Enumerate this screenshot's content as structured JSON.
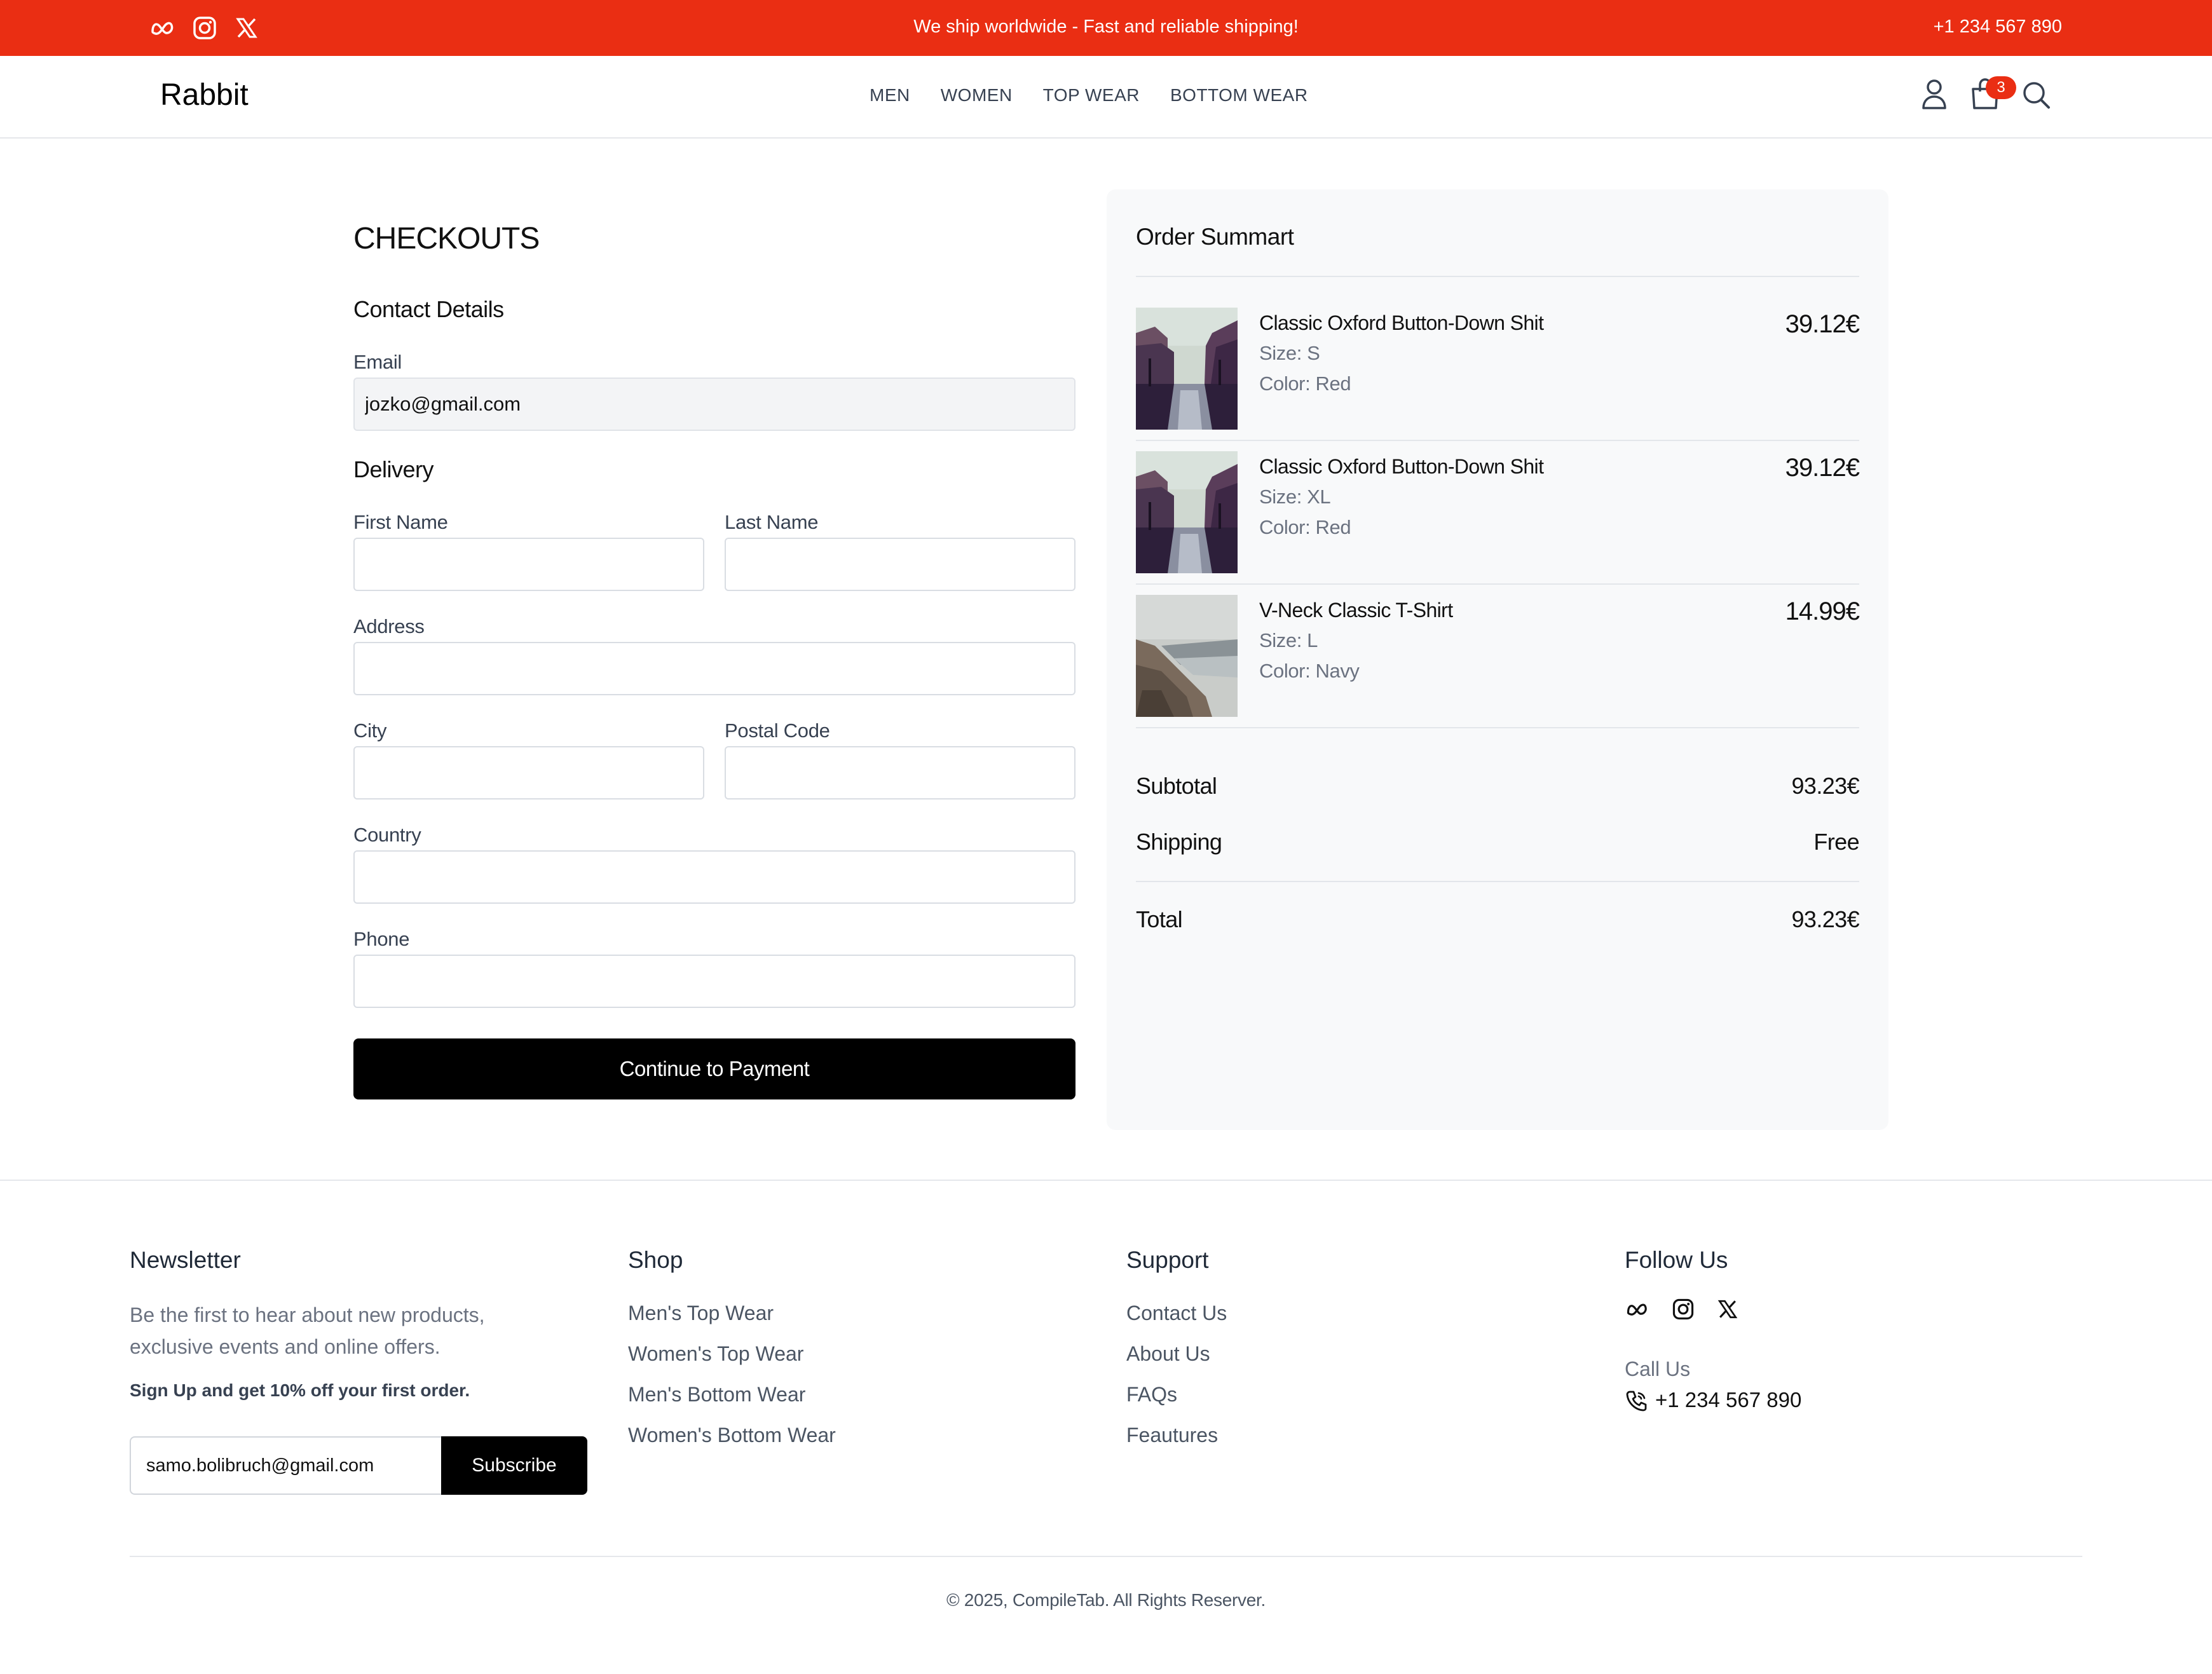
{
  "topbar": {
    "social_icons": [
      "meta-icon",
      "instagram-icon",
      "x-icon"
    ],
    "message": "We ship worldwide - Fast and reliable shipping!",
    "phone": "+1 234 567 890",
    "color": "#ea2e13"
  },
  "navbar": {
    "logo": "Rabbit",
    "links": [
      "MEN",
      "WOMEN",
      "TOP WEAR",
      "BOTTOM WEAR"
    ],
    "icons": [
      "user-icon",
      "shopping-bag-icon",
      "search-icon"
    ],
    "cart_count": "3"
  },
  "checkout": {
    "title": "CHECKOUTS",
    "contact_title": "Contact Details",
    "email_label": "Email",
    "email_value": "jozko@gmail.com",
    "delivery_title": "Delivery",
    "first_name_label": "First Name",
    "last_name_label": "Last Name",
    "address_label": "Address",
    "city_label": "City",
    "postal_label": "Postal Code",
    "country_label": "Country",
    "phone_label": "Phone",
    "submit_label": "Continue to Payment"
  },
  "summary": {
    "title": "Order Summart",
    "items": [
      {
        "name": "Classic Oxford Button-Down Shit",
        "size": "Size: S",
        "color": "Color: Red",
        "price": "39.12€"
      },
      {
        "name": "Classic Oxford Button-Down Shit",
        "size": "Size: XL",
        "color": "Color: Red",
        "price": "39.12€"
      },
      {
        "name": "V-Neck Classic T-Shirt",
        "size": "Size: L",
        "color": "Color: Navy",
        "price": "14.99€"
      }
    ],
    "subtotal_label": "Subtotal",
    "subtotal_value": "93.23€",
    "shipping_label": "Shipping",
    "shipping_value": "Free",
    "total_label": "Total",
    "total_value": "93.23€"
  },
  "footer": {
    "newsletter": {
      "title": "Newsletter",
      "text": "Be the first to hear about new products, exclusive events and online offers.",
      "bold": "Sign Up and get 10% off your first order.",
      "email_value": "samo.bolibruch@gmail.com",
      "button": "Subscribe"
    },
    "shop": {
      "title": "Shop",
      "links": [
        "Men's Top Wear",
        "Women's Top Wear",
        "Men's Bottom Wear",
        "Women's Bottom Wear"
      ]
    },
    "support": {
      "title": "Support",
      "links": [
        "Contact Us",
        "About Us",
        "FAQs",
        "Feautures"
      ]
    },
    "follow": {
      "title": "Follow Us",
      "icons": [
        "meta-icon",
        "instagram-icon",
        "x-icon"
      ],
      "call_label": "Call Us",
      "phone": "+1 234 567 890"
    },
    "copyright": "© 2025, CompileTab. All Rights Reserver."
  }
}
